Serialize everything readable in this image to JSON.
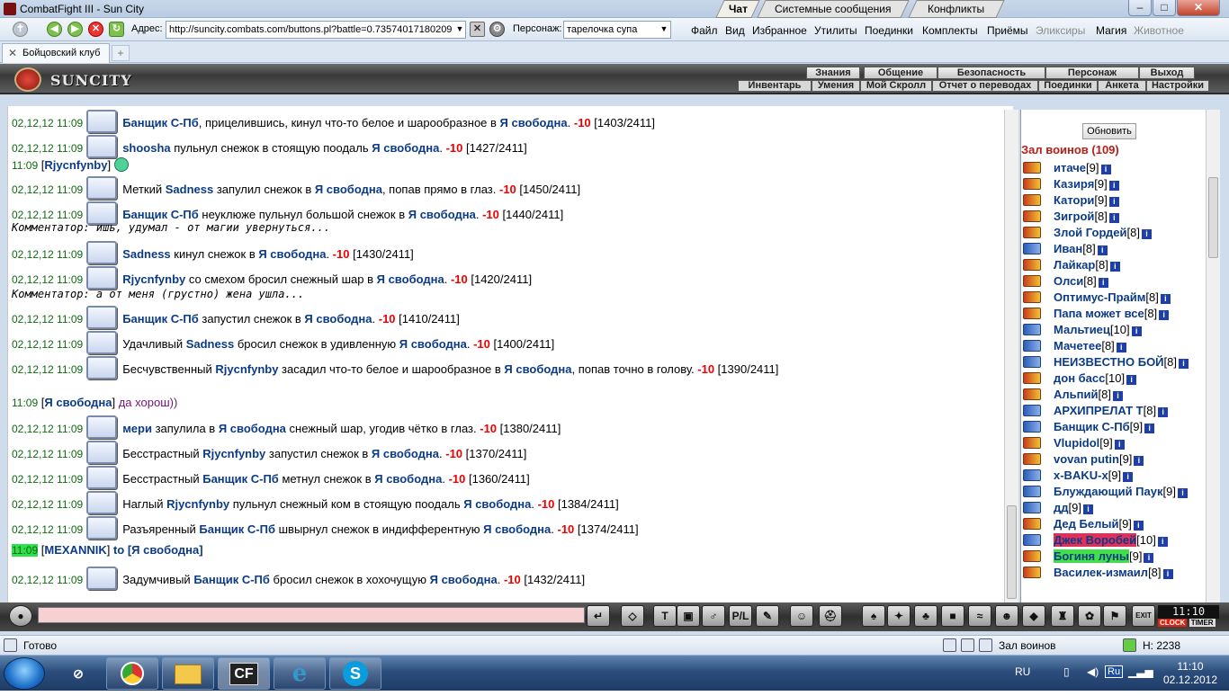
{
  "window": {
    "title": "CombatFight III - Sun City",
    "min": "–",
    "max": "□",
    "close": "✕"
  },
  "toolbar": {
    "address_label": "Адрес:",
    "address_value": "http://suncity.combats.com/buttons.pl?battle=0.73574017180209",
    "persona_label": "Персонаж:",
    "persona_value": "тарелочка супа",
    "menus": [
      {
        "label": "Файл",
        "disabled": false
      },
      {
        "label": "Вид",
        "disabled": false
      },
      {
        "label": "Избранное",
        "disabled": false
      },
      {
        "label": "Утилиты",
        "disabled": false
      },
      {
        "label": "Поединки",
        "disabled": false
      },
      {
        "label": "Комплекты",
        "disabled": false
      },
      {
        "label": "Приёмы",
        "disabled": false
      },
      {
        "label": "Эликсиры",
        "disabled": true
      },
      {
        "label": "Магия",
        "disabled": false
      },
      {
        "label": "Животное",
        "disabled": true
      }
    ]
  },
  "tab": {
    "label": "Бойцовский клуб",
    "new_tab": "+"
  },
  "game_header": {
    "logo_text": "SUNCITY",
    "top_nav": [
      "Знания",
      "Общение",
      "Безопасность",
      "Персонаж",
      "Выход"
    ],
    "sub_nav": [
      "Инвентарь",
      "Умения",
      "Мой Скролл",
      "Отчет о переводах",
      "Поединки",
      "Анкета",
      "Настройки"
    ]
  },
  "chat_tabs": [
    "Чат",
    "Системные сообщения",
    "Конфликты"
  ],
  "chat": [
    {
      "type": "hit",
      "time": "02,12,12 11:09",
      "parts": [
        [
          "n",
          "Банщик С-Пб"
        ],
        [
          "t",
          ", прицелившись, кинул что-то белое и шарообразное в "
        ],
        [
          "n",
          "Я свободна"
        ],
        [
          "t",
          ". "
        ],
        [
          "d",
          "-10"
        ],
        [
          "t",
          " [1403/2411]"
        ]
      ]
    },
    {
      "type": "hit",
      "time": "02,12,12 11:09",
      "parts": [
        [
          "n",
          "shoosha"
        ],
        [
          "t",
          " пульнул снежок в стоящую поодаль "
        ],
        [
          "n",
          "Я свободна"
        ],
        [
          "t",
          ". "
        ],
        [
          "d",
          "-10"
        ],
        [
          "t",
          " [1427/2411]"
        ]
      ]
    },
    {
      "type": "say",
      "time": "11:09",
      "parts": [
        [
          "t",
          "["
        ],
        [
          "n",
          "Rjycnfynby"
        ],
        [
          "t",
          "]"
        ]
      ],
      "smiley": true
    },
    {
      "type": "hit",
      "time": "02,12,12 11:09",
      "parts": [
        [
          "t",
          "Меткий "
        ],
        [
          "n",
          "Sadness"
        ],
        [
          "t",
          " запулил снежок в "
        ],
        [
          "n",
          "Я свободна"
        ],
        [
          "t",
          ", попав прямо в глаз. "
        ],
        [
          "d",
          "-10"
        ],
        [
          "t",
          " [1450/2411]"
        ]
      ]
    },
    {
      "type": "hit",
      "time": "02,12,12 11:09",
      "parts": [
        [
          "n",
          "Банщик С-Пб"
        ],
        [
          "t",
          " неуклюже пульнул большой снежок в "
        ],
        [
          "n",
          "Я свободна"
        ],
        [
          "t",
          ". "
        ],
        [
          "d",
          "-10"
        ],
        [
          "t",
          " [1440/2411]"
        ]
      ]
    },
    {
      "type": "comment",
      "text": "Комментатор: ишь, удумал - от магии увернуться..."
    },
    {
      "type": "hit",
      "time": "02,12,12 11:09",
      "parts": [
        [
          "n",
          "Sadness"
        ],
        [
          "t",
          " кинул снежок в "
        ],
        [
          "n",
          "Я свободна"
        ],
        [
          "t",
          ". "
        ],
        [
          "d",
          "-10"
        ],
        [
          "t",
          " [1430/2411]"
        ]
      ]
    },
    {
      "type": "hit",
      "time": "02,12,12 11:09",
      "parts": [
        [
          "n",
          "Rjycnfynby"
        ],
        [
          "t",
          " со смехом бросил снежный шар в "
        ],
        [
          "n",
          "Я свободна"
        ],
        [
          "t",
          ". "
        ],
        [
          "d",
          "-10"
        ],
        [
          "t",
          " [1420/2411]"
        ]
      ]
    },
    {
      "type": "comment",
      "text": "Комментатор: а от меня (грустно) жена ушла..."
    },
    {
      "type": "hit",
      "time": "02,12,12 11:09",
      "parts": [
        [
          "n",
          "Банщик С-Пб"
        ],
        [
          "t",
          " запустил снежок в "
        ],
        [
          "n",
          "Я свободна"
        ],
        [
          "t",
          ". "
        ],
        [
          "d",
          "-10"
        ],
        [
          "t",
          " [1410/2411]"
        ]
      ]
    },
    {
      "type": "hit",
      "time": "02,12,12 11:09",
      "parts": [
        [
          "t",
          "Удачливый "
        ],
        [
          "n",
          "Sadness"
        ],
        [
          "t",
          " бросил снежок в удивленную "
        ],
        [
          "n",
          "Я свободна"
        ],
        [
          "t",
          ". "
        ],
        [
          "d",
          "-10"
        ],
        [
          "t",
          " [1400/2411]"
        ]
      ]
    },
    {
      "type": "hit",
      "time": "02,12,12 11:09",
      "parts": [
        [
          "t",
          "Бесчувственный "
        ],
        [
          "n",
          "Rjycnfynby"
        ],
        [
          "t",
          " засадил что-то белое и шарообразное в "
        ],
        [
          "n",
          "Я свободна"
        ],
        [
          "t",
          ", попав точно в голову. "
        ],
        [
          "d",
          "-10"
        ],
        [
          "t",
          " [1390/2411]"
        ]
      ]
    },
    {
      "type": "say",
      "time": "11:09",
      "parts": [
        [
          "t",
          "["
        ],
        [
          "n",
          "Я свободна"
        ],
        [
          "t",
          "] "
        ],
        [
          "p",
          "да хорош))"
        ]
      ]
    },
    {
      "type": "hit",
      "time": "02,12,12 11:09",
      "parts": [
        [
          "n",
          "мери"
        ],
        [
          "t",
          " запулила в "
        ],
        [
          "n",
          "Я свободна"
        ],
        [
          "t",
          " снежный шар, угодив чётко в глаз. "
        ],
        [
          "d",
          "-10"
        ],
        [
          "t",
          " [1380/2411]"
        ]
      ]
    },
    {
      "type": "hit",
      "time": "02,12,12 11:09",
      "parts": [
        [
          "t",
          "Бесстрастный "
        ],
        [
          "n",
          "Rjycnfynby"
        ],
        [
          "t",
          " запустил снежок в "
        ],
        [
          "n",
          "Я свободна"
        ],
        [
          "t",
          ". "
        ],
        [
          "d",
          "-10"
        ],
        [
          "t",
          " [1370/2411]"
        ]
      ]
    },
    {
      "type": "hit",
      "time": "02,12,12 11:09",
      "parts": [
        [
          "t",
          "Бесстрастный "
        ],
        [
          "n",
          "Банщик С-Пб"
        ],
        [
          "t",
          " метнул снежок в "
        ],
        [
          "n",
          "Я свободна"
        ],
        [
          "t",
          ". "
        ],
        [
          "d",
          "-10"
        ],
        [
          "t",
          " [1360/2411]"
        ]
      ]
    },
    {
      "type": "hit",
      "time": "02,12,12 11:09",
      "parts": [
        [
          "t",
          "Наглый "
        ],
        [
          "n",
          "Rjycnfynby"
        ],
        [
          "t",
          " пульнул снежный ком в стоящую поодаль "
        ],
        [
          "n",
          "Я свободна"
        ],
        [
          "t",
          ". "
        ],
        [
          "d",
          "-10"
        ],
        [
          "t",
          " [1384/2411]"
        ]
      ]
    },
    {
      "type": "hit",
      "time": "02,12,12 11:09",
      "parts": [
        [
          "t",
          "Разъяренный "
        ],
        [
          "n",
          "Банщик С-Пб"
        ],
        [
          "t",
          " швырнул снежок в индифферентную "
        ],
        [
          "n",
          "Я свободна"
        ],
        [
          "t",
          ". "
        ],
        [
          "d",
          "-10"
        ],
        [
          "t",
          " [1374/2411]"
        ]
      ]
    },
    {
      "type": "say_hl",
      "time": "11:09",
      "parts": [
        [
          "t",
          "["
        ],
        [
          "n",
          "MEXANNIK"
        ],
        [
          "t",
          "] "
        ],
        [
          "n",
          "to [Я свободна]"
        ]
      ]
    },
    {
      "type": "hit",
      "time": "02,12,12 11:09",
      "parts": [
        [
          "t",
          "Задумчивый "
        ],
        [
          "n",
          "Банщик С-Пб"
        ],
        [
          "t",
          " бросил снежок в хохочущую "
        ],
        [
          "n",
          "Я свободна"
        ],
        [
          "t",
          ". "
        ],
        [
          "d",
          "-10"
        ],
        [
          "t",
          " [1432/2411]"
        ]
      ]
    }
  ],
  "side": {
    "refresh": "Обновить",
    "room_title": "Зал воинов (109)",
    "players": [
      {
        "name": "итаче",
        "level": "[9]",
        "icon": "red"
      },
      {
        "name": "Казиря",
        "level": "[9]",
        "icon": "red"
      },
      {
        "name": "Катори",
        "level": "[9]",
        "icon": "red"
      },
      {
        "name": "Зигрой",
        "level": "[8]",
        "icon": "red"
      },
      {
        "name": "Злой Гордей",
        "level": "[8]",
        "icon": "red"
      },
      {
        "name": "Иван",
        "level": "[8]",
        "icon": "blue"
      },
      {
        "name": "Лайкар",
        "level": "[8]",
        "icon": "red"
      },
      {
        "name": "Олси",
        "level": "[8]",
        "icon": "red"
      },
      {
        "name": "Оптимус-Прайм",
        "level": "[8]",
        "icon": "red"
      },
      {
        "name": "Папа может все",
        "level": "[8]",
        "icon": "red"
      },
      {
        "name": "Мальтиец",
        "level": "[10]",
        "icon": "blue"
      },
      {
        "name": "Мачетее",
        "level": "[8]",
        "icon": "blue"
      },
      {
        "name": "НЕИЗВЕСТНО БОЙ",
        "level": "[8]",
        "icon": "blue"
      },
      {
        "name": "дон басс",
        "level": "[10]",
        "icon": "red"
      },
      {
        "name": "Альпий",
        "level": "[8]",
        "icon": "red"
      },
      {
        "name": "АРХИПРЕЛАТ Т",
        "level": "[8]",
        "icon": "blue"
      },
      {
        "name": "Банщик С-Пб",
        "level": "[9]",
        "icon": "blue"
      },
      {
        "name": "Vlupidol",
        "level": "[9]",
        "icon": "red"
      },
      {
        "name": "vovan putin",
        "level": "[9]",
        "icon": "red"
      },
      {
        "name": "x-BAKU-x",
        "level": "[9]",
        "icon": "blue"
      },
      {
        "name": "Блуждающий Паук",
        "level": "[9]",
        "icon": "blue"
      },
      {
        "name": "дд",
        "level": "[9]",
        "icon": "blue"
      },
      {
        "name": "Дед Белый",
        "level": "[9]",
        "icon": "red"
      },
      {
        "name": "Джек Воробей",
        "level": "[10]",
        "icon": "blue",
        "hl": "red"
      },
      {
        "name": "Богиня луны",
        "level": "[9]",
        "icon": "red",
        "hl": "green"
      },
      {
        "name": "Василек-измаил",
        "level": "[8]",
        "icon": "red"
      }
    ]
  },
  "bottom": {
    "clock": "11:10",
    "clock_label": "CLOCK",
    "timer_label": "TIMER",
    "exit": "EXIT"
  },
  "status": {
    "ready": "Готово",
    "zone": "Зал воинов",
    "health": "H: 2238"
  },
  "taskbar": {
    "lang": "RU",
    "time": "11:10",
    "date": "02.12.2012",
    "apps": [
      "chrome",
      "explorer",
      "CF",
      "ie",
      "skype"
    ]
  }
}
